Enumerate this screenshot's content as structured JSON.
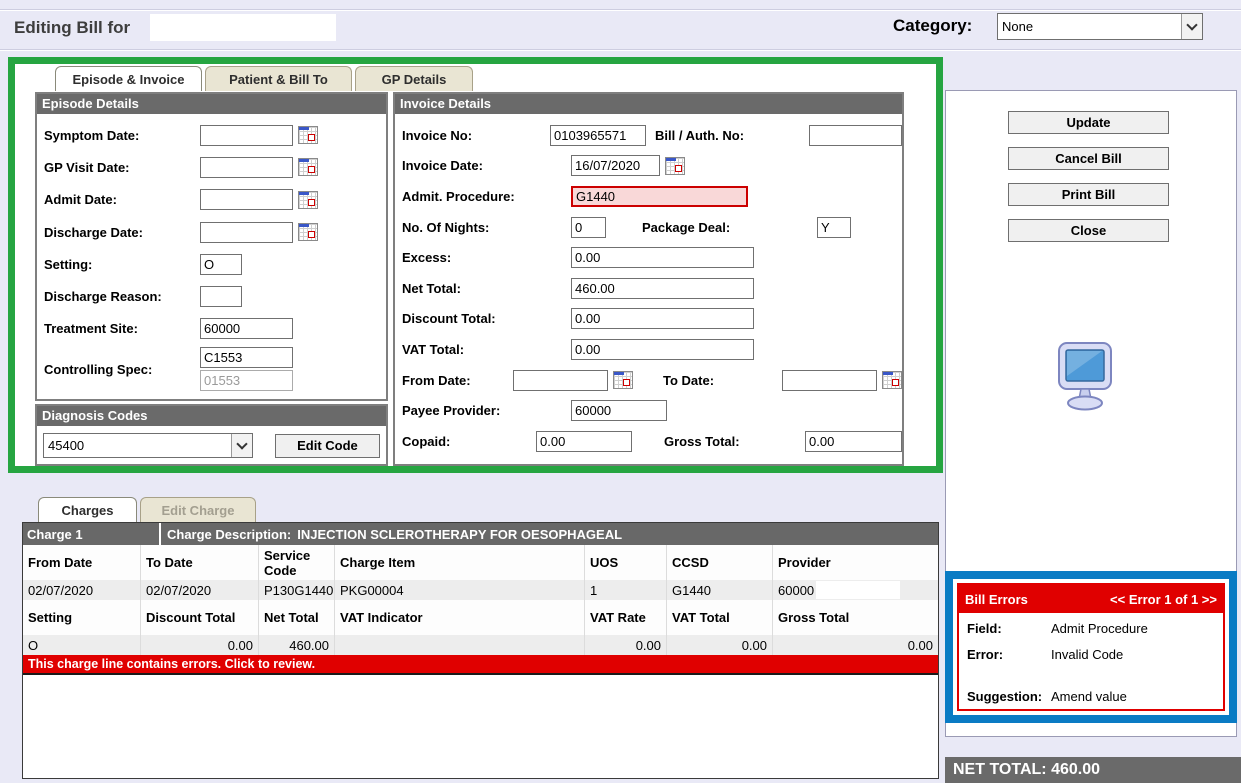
{
  "header": {
    "title": "Editing Bill for",
    "bill_for_value": "",
    "category_label": "Category:",
    "category_value": "None"
  },
  "main_tabs": [
    {
      "label": "Episode & Invoice"
    },
    {
      "label": "Patient & Bill To"
    },
    {
      "label": "GP Details"
    }
  ],
  "episode_details": {
    "title": "Episode Details",
    "symptom_date": {
      "label": "Symptom Date:",
      "value": ""
    },
    "gp_visit_date": {
      "label": "GP Visit Date:",
      "value": ""
    },
    "admit_date": {
      "label": "Admit Date:",
      "value": ""
    },
    "discharge_date": {
      "label": "Discharge Date:",
      "value": ""
    },
    "setting": {
      "label": "Setting:",
      "value": "O"
    },
    "discharge_reason": {
      "label": "Discharge Reason:",
      "value": ""
    },
    "treatment_site": {
      "label": "Treatment Site:",
      "value": "60000"
    },
    "controlling_spec": {
      "label": "Controlling Spec:",
      "value": "C1553",
      "value_secondary": "01553"
    }
  },
  "diagnosis_codes": {
    "title": "Diagnosis Codes",
    "selected_code": "45400",
    "edit_button": "Edit Code"
  },
  "invoice_details": {
    "title": "Invoice Details",
    "invoice_no": {
      "label": "Invoice No:",
      "value": "0103965571"
    },
    "bill_auth_no": {
      "label": "Bill / Auth. No:",
      "value": ""
    },
    "invoice_date": {
      "label": "Invoice Date:",
      "value": "16/07/2020"
    },
    "admit_procedure": {
      "label": "Admit. Procedure:",
      "value": "G1440"
    },
    "no_of_nights": {
      "label": "No. Of Nights:",
      "value": "0"
    },
    "package_deal": {
      "label": "Package Deal:",
      "value": "Y"
    },
    "excess": {
      "label": "Excess:",
      "value": "0.00"
    },
    "net_total": {
      "label": "Net Total:",
      "value": "460.00"
    },
    "discount_total": {
      "label": "Discount Total:",
      "value": "0.00"
    },
    "vat_total": {
      "label": "VAT Total:",
      "value": "0.00"
    },
    "from_date": {
      "label": "From Date:",
      "value": ""
    },
    "to_date": {
      "label": "To Date:",
      "value": ""
    },
    "payee_provider": {
      "label": "Payee Provider:",
      "value": "60000"
    },
    "copaid": {
      "label": "Copaid:",
      "value": "0.00"
    },
    "gross_total": {
      "label": "Gross Total:",
      "value": "0.00"
    }
  },
  "action_buttons": [
    "Update",
    "Cancel Bill",
    "Print Bill",
    "Close"
  ],
  "charges_tabs": [
    {
      "label": "Charges"
    },
    {
      "label": "Edit Charge"
    }
  ],
  "charge": {
    "charge_label": "Charge 1",
    "description_label": "Charge Description:",
    "description_value": "INJECTION SCLEROTHERAPY FOR OESOPHAGEAL",
    "row1_headers": [
      "From Date",
      "To Date",
      "Service Code",
      "Charge Item",
      "UOS",
      "CCSD",
      "Provider"
    ],
    "row1_values": [
      "02/07/2020",
      "02/07/2020",
      "P130G1440",
      "PKG00004",
      "1",
      "G1440",
      "60000"
    ],
    "row2_headers": [
      "Setting",
      "Discount Total",
      "Net Total",
      "VAT Indicator",
      "VAT Rate",
      "VAT Total",
      "Gross Total"
    ],
    "row2_values": [
      "O",
      "0.00",
      "460.00",
      "",
      "0.00",
      "0.00",
      "0.00"
    ],
    "error_message": "This charge line contains errors. Click to review."
  },
  "bill_errors": {
    "title": "Bill Errors",
    "pager": "<< Error 1 of 1 >>",
    "field_label": "Field:",
    "field_value": "Admit Procedure",
    "error_label": "Error:",
    "error_value": "Invalid Code",
    "suggestion_label": "Suggestion:",
    "suggestion_value": "Amend value"
  },
  "footer": {
    "net_total": "NET TOTAL: 460.00"
  },
  "colors": {
    "annotation_green": "#26a541",
    "annotation_blue": "#0a7bc4",
    "error_red": "#e00000",
    "header_gray": "#6a6a6a"
  }
}
